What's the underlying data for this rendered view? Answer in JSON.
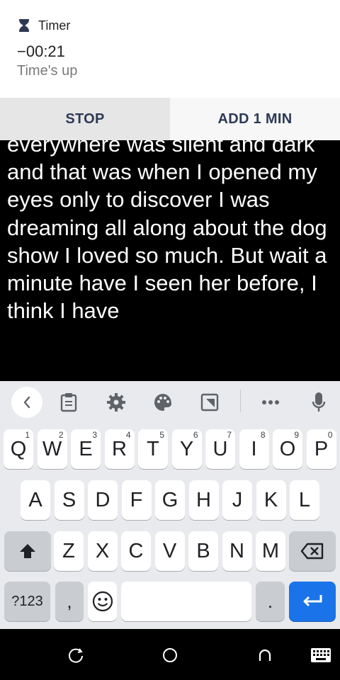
{
  "notification": {
    "app_name": "Timer",
    "timer_value": "−00:21",
    "status": "Time's up",
    "actions": {
      "stop": "STOP",
      "add_minute": "ADD 1 MIN"
    }
  },
  "editor": {
    "text": "everywhere was silent and dark and that was when I opened my eyes only to discover I was dreaming all along about the dog show I loved so much. But wait a minute have I seen her before, I think I have"
  },
  "keyboard": {
    "toolbar_icons": [
      "chevron-left-icon",
      "clipboard-icon",
      "gear-icon",
      "palette-icon",
      "resize-icon",
      "more-icon",
      "microphone-icon"
    ],
    "row1": [
      {
        "label": "Q",
        "hint": "1"
      },
      {
        "label": "W",
        "hint": "2"
      },
      {
        "label": "E",
        "hint": "3"
      },
      {
        "label": "R",
        "hint": "4"
      },
      {
        "label": "T",
        "hint": "5"
      },
      {
        "label": "Y",
        "hint": "6"
      },
      {
        "label": "U",
        "hint": "7"
      },
      {
        "label": "I",
        "hint": "8"
      },
      {
        "label": "O",
        "hint": "9"
      },
      {
        "label": "P",
        "hint": "0"
      }
    ],
    "row2": [
      "A",
      "S",
      "D",
      "F",
      "G",
      "H",
      "J",
      "K",
      "L"
    ],
    "row3": [
      "Z",
      "X",
      "C",
      "V",
      "B",
      "N",
      "M"
    ],
    "symbols_label": "?123",
    "comma_label": ",",
    "period_label": "."
  },
  "navbar_icons": [
    "rotate-icon",
    "home-icon",
    "back-icon",
    "keyboard-icon"
  ],
  "colors": {
    "accent": "#1a73e8",
    "keyboard_bg": "#e8eaed",
    "notification_button_text": "#2d3a56"
  }
}
